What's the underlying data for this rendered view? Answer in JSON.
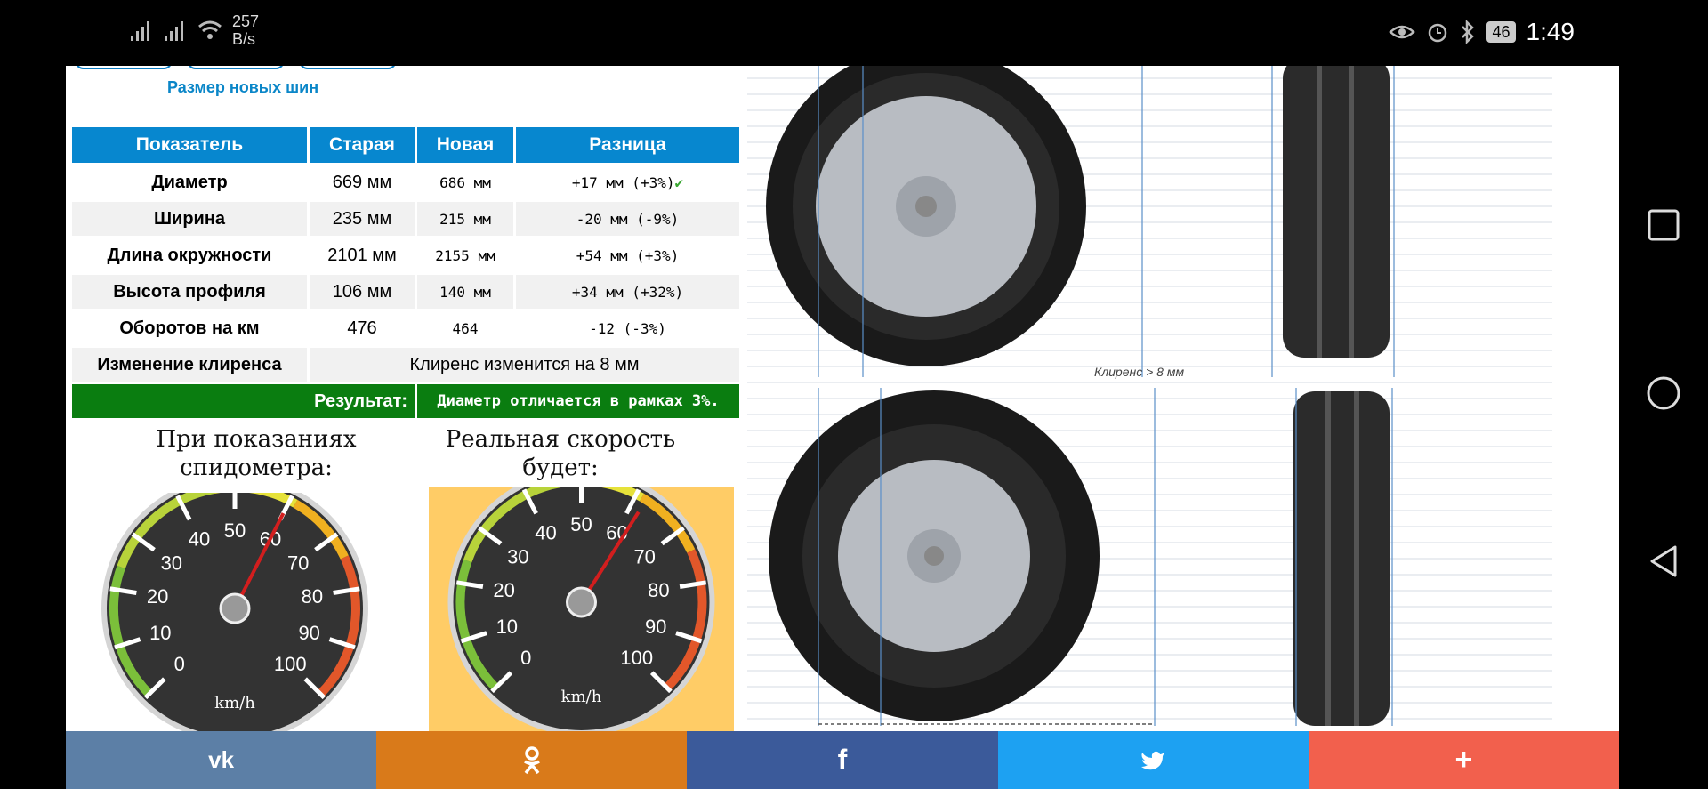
{
  "status": {
    "net_speed_value": "257",
    "net_speed_unit": "B/s",
    "battery": "46",
    "time": "1:49"
  },
  "page": {
    "link_new_size": "Размер новых шин",
    "table": {
      "headers": [
        "Показатель",
        "Старая",
        "Новая",
        "Разница"
      ],
      "rows": [
        {
          "label": "Диаметр",
          "old": "669 мм",
          "new": "686 мм",
          "diff": "+17 мм (+3%)"
        },
        {
          "label": "Ширина",
          "old": "235 мм",
          "new": "215 мм",
          "diff": "-20 мм (-9%)"
        },
        {
          "label": "Длина окружности",
          "old": "2101 мм",
          "new": "2155 мм",
          "diff": "+54 мм (+3%)"
        },
        {
          "label": "Высота профиля",
          "old": "106 мм",
          "new": "140 мм",
          "diff": "+34 мм (+32%)"
        },
        {
          "label": "Оборотов на км",
          "old": "476",
          "new": "464",
          "diff": "-12 (-3%)"
        }
      ],
      "clearance_label": "Изменение клиренса",
      "clearance_value": "Клиренс изменится на 8 мм",
      "result_label": "Результат:",
      "result_value": "Диаметр отличается в рамках 3%."
    },
    "gauge_left_title": "При показаниях спидометра:",
    "gauge_right_title": "Реальная скорость будет:",
    "gauge_ticks": [
      "0",
      "10",
      "20",
      "30",
      "40",
      "50",
      "60",
      "70",
      "80",
      "90",
      "100"
    ],
    "gauge_unit": "km/h",
    "gauge_left_speed": 60,
    "gauge_right_speed": 62,
    "clearance_caption": "Клиренс > 8 мм"
  },
  "share": {
    "vk": "vk",
    "ok": "ok",
    "facebook": "f",
    "twitter": "twitter",
    "more": "+"
  },
  "colors": {
    "table_header": "#0787cf",
    "result_bar": "#0a7d10",
    "gauge_highlight": "#ffcc66",
    "share_vk": "#5c7fa6",
    "share_ok": "#d97a1a",
    "share_fb": "#3b5a9a",
    "share_tw": "#1da1f2",
    "share_more": "#f2604d"
  }
}
